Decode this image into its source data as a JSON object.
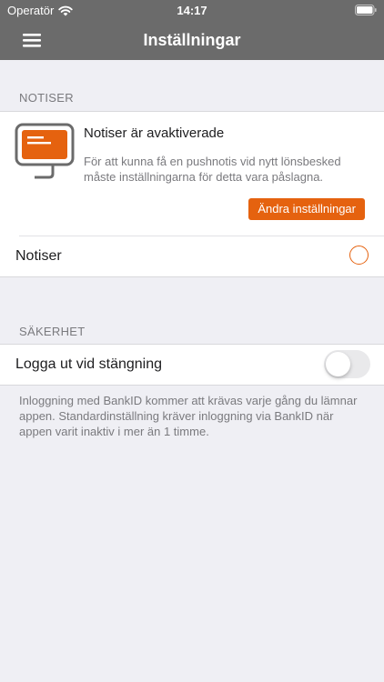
{
  "status_bar": {
    "carrier": "Operatör",
    "time": "14:17",
    "wifi_icon": "wifi-icon",
    "battery_icon": "battery-icon"
  },
  "nav": {
    "title": "Inställningar",
    "menu_icon": "hamburger-menu-icon"
  },
  "notifications": {
    "section_header": "NOTISER",
    "illustration_icon": "monitor-message-icon",
    "title": "Notiser är avaktiverade",
    "body": "För att kunna få  en pushnotis vid nytt lönsbesked\nmåste inställningarna för detta vara påslagna.",
    "button_label": "Ändra inställningar",
    "row_label": "Notiser",
    "row_selected": false
  },
  "security": {
    "section_header": "SÄKERHET",
    "logout_label": "Logga ut vid stängning",
    "logout_enabled": false,
    "footer": "Inloggning med BankID kommer att krävas varje gång du lämnar appen. Standardinställning kräver inloggning via BankID när appen varit inaktiv i mer än 1 timme."
  },
  "colors": {
    "accent": "#e5620f",
    "nav_background": "#6b6b6b",
    "page_background": "#efeff4",
    "secondary_text": "#7a7a7e"
  }
}
